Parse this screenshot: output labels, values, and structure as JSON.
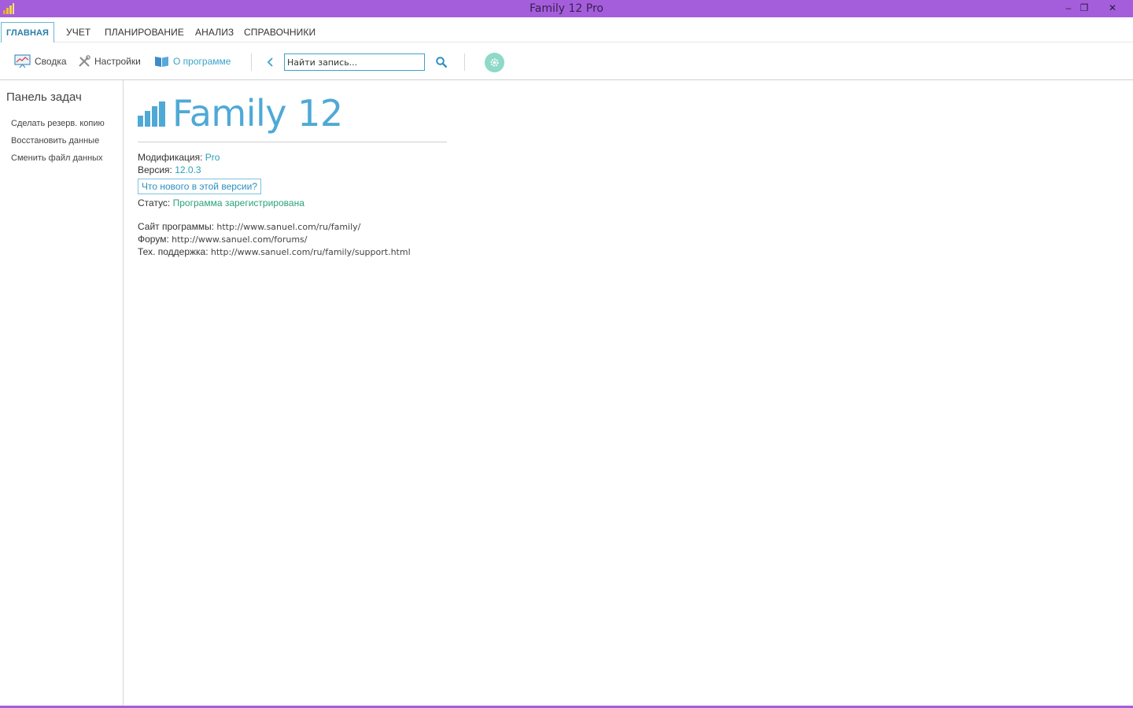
{
  "window": {
    "title": "Family 12 Pro",
    "minimize": "–",
    "maximize": "❐",
    "close": "✕"
  },
  "menu": {
    "tabs": [
      "ГЛАВНАЯ",
      "УЧЕТ",
      "ПЛАНИРОВАНИЕ",
      "АНАЛИЗ",
      "СПРАВОЧНИКИ"
    ],
    "active_tab": "ГЛАВНАЯ"
  },
  "toolbar": {
    "summary_label": "Сводка",
    "settings_label": "Настройки",
    "about_label": "О программе",
    "search_placeholder": "Найти запись..."
  },
  "leftpanel": {
    "title": "Панель задач",
    "tasks": [
      "Сделать резерв. копию",
      "Восстановить данные",
      "Сменить файл данных"
    ]
  },
  "about": {
    "logo_text": "Family 12",
    "modification_label": "Модификация:",
    "modification_value": "Pro",
    "version_label": "Версия:",
    "version_value": "12.0.3",
    "whats_new": "Что нового в этой версии?",
    "status_label": "Статус:",
    "status_value": "Программа зарегистрирована",
    "site_label": "Сайт программы:",
    "site_url": "http://www.sanuel.com/ru/family/",
    "forum_label": "Форум:",
    "forum_url": "http://www.sanuel.com/forums/",
    "support_label": "Тех. поддержка:",
    "support_url": "http://www.sanuel.com/ru/family/support.html"
  },
  "colors": {
    "titlebar": "#a45edb",
    "accent": "#3aa3c9",
    "status": "#2aa37a",
    "logo": "#4fa9d6"
  }
}
